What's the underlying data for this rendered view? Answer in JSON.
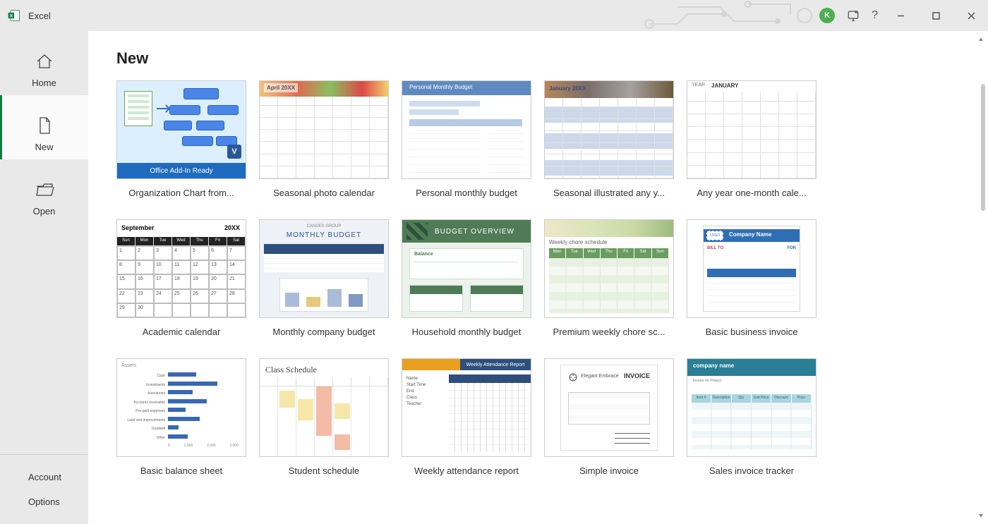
{
  "app": {
    "name": "Excel",
    "user_initial": "K"
  },
  "title_controls": {
    "help": "?",
    "minimize": "–",
    "maximize": "▢",
    "close": "✕"
  },
  "sidebar": {
    "items": [
      {
        "label": "Home"
      },
      {
        "label": "New"
      },
      {
        "label": "Open"
      }
    ],
    "selected_index": 1,
    "bottom": {
      "account": "Account",
      "options": "Options"
    }
  },
  "page": {
    "heading": "New"
  },
  "templates": [
    {
      "caption": "Organization Chart from...",
      "addin_bar": "Office Add-In Ready",
      "visio_badge": "V"
    },
    {
      "caption": "Seasonal photo calendar",
      "header": "April 20XX"
    },
    {
      "caption": "Personal monthly budget",
      "header": "Personal Monthly Budget"
    },
    {
      "caption": "Seasonal illustrated any y...",
      "header": "January 20XX"
    },
    {
      "caption": "Any year one-month cale...",
      "year": "YEAR",
      "month": "JANUARY"
    },
    {
      "caption": "Academic calendar",
      "month": "September",
      "year": "20XX"
    },
    {
      "caption": "Monthly company budget",
      "subtitle": "CANDES GROUP",
      "title": "MONTHLY BUDGET"
    },
    {
      "caption": "Household monthly budget",
      "title": "BUDGET OVERVIEW"
    },
    {
      "caption": "Premium weekly chore sc...",
      "label": "Weekly chore schedule"
    },
    {
      "caption": "Basic business invoice",
      "logo": "LOGO",
      "company": "Company Name",
      "bill": "BILL TO",
      "for": "FOR"
    },
    {
      "caption": "Basic balance sheet",
      "title": "Assets"
    },
    {
      "caption": "Student schedule",
      "title": "Class Schedule"
    },
    {
      "caption": "Weekly attendance report",
      "pill": "Weekly Attendance Report"
    },
    {
      "caption": "Simple invoice",
      "brand": "Elegant Embrace",
      "inv": "INVOICE"
    },
    {
      "caption": "Sales invoice tracker",
      "company": "company name",
      "meta": "Invoice for Project"
    }
  ],
  "weekdays_short": [
    "Sun",
    "Mon",
    "Tue",
    "Wed",
    "Thu",
    "Fri",
    "Sat"
  ],
  "chore_days": [
    "Mon",
    "Tue",
    "Wed",
    "Thu",
    "Fri",
    "Sat",
    "Sun"
  ],
  "balance_rows": [
    "Cash",
    "Investments",
    "Inventories",
    "Accounts receivable",
    "Pre-paid expenses",
    "Land and improvements",
    "Goodwill",
    "Other"
  ],
  "sit_cols": [
    "Item #",
    "Description",
    "Qty",
    "Unit Price",
    "Discount",
    "Price"
  ]
}
